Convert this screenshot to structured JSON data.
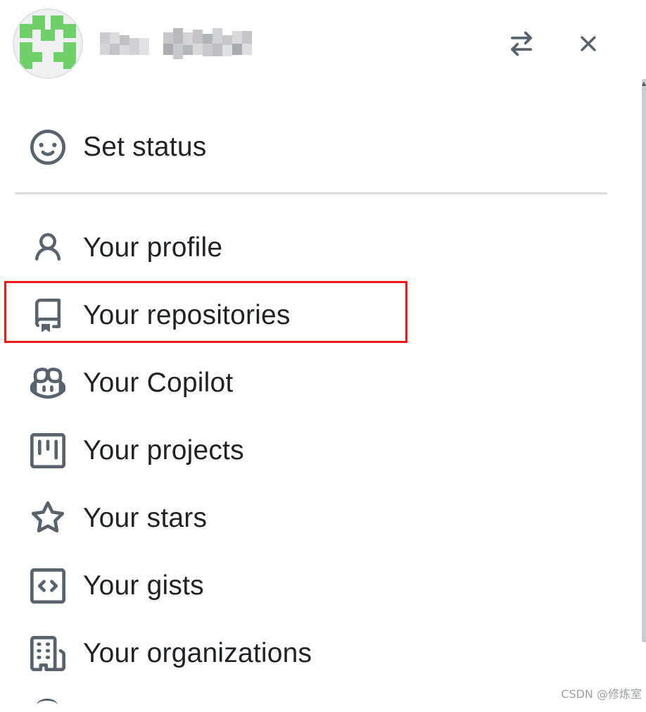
{
  "header": {
    "avatar_icon": "identicon",
    "username": "",
    "switch_account_icon": "arrow-switch-icon",
    "close_icon": "close-icon"
  },
  "menu": {
    "set_status": {
      "label": "Set status",
      "icon": "smiley-icon"
    },
    "items": [
      {
        "label": "Your profile",
        "icon": "person-icon"
      },
      {
        "label": "Your repositories",
        "icon": "repo-icon"
      },
      {
        "label": "Your Copilot",
        "icon": "copilot-icon"
      },
      {
        "label": "Your projects",
        "icon": "project-icon"
      },
      {
        "label": "Your stars",
        "icon": "star-icon"
      },
      {
        "label": "Your gists",
        "icon": "code-square-icon"
      },
      {
        "label": "Your organizations",
        "icon": "organization-icon"
      }
    ]
  },
  "annotation": {
    "highlight_color": "#ee1a1a",
    "highlighted_item": "Your repositories"
  },
  "watermark": "CSDN @修炼室",
  "colors": {
    "icon": "#59636e",
    "text": "#1f2328",
    "divider": "#d8dee4",
    "identicon": "#6fcf68"
  }
}
